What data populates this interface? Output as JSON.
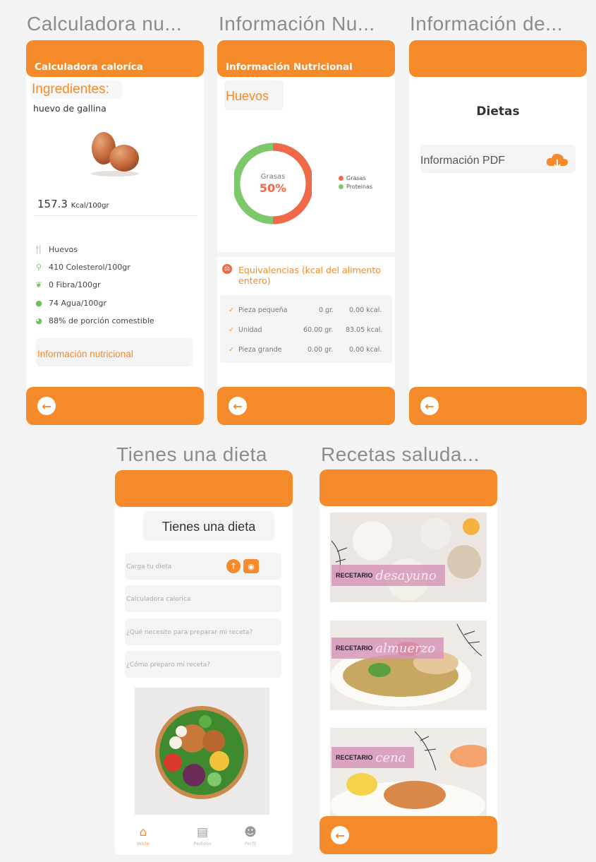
{
  "frames": {
    "calc": "Calculadora nu...",
    "info": "Información Nu...",
    "diet_info": "Información de...",
    "diet": "Tienes una dieta",
    "recipes": "Recetas saluda..."
  },
  "calc_screen": {
    "header": "Calculadora caloríca",
    "ingredients_label": "Ingredientes:",
    "ingredient": "huevo de gallina",
    "kcal_value": "157.3",
    "kcal_unit": "Kcal/100gr",
    "items": [
      {
        "icon": "fork-knife-icon",
        "text": "Huevos"
      },
      {
        "icon": "molecule-icon",
        "text": "410 Colesterol/100gr"
      },
      {
        "icon": "leaf-icon",
        "text": "0 Fibra/100gr"
      },
      {
        "icon": "drop-icon",
        "text": "74 Agua/100gr"
      },
      {
        "icon": "pie-icon",
        "text": "88% de porción comestible"
      }
    ],
    "nutrition_button": "Información nutricional"
  },
  "info_screen": {
    "header": "Información Nutricional",
    "food": "Huevos",
    "donut_label": "Grasas",
    "donut_percent": "50%",
    "legend": [
      {
        "name": "Grasas",
        "color": "#f06a4a"
      },
      {
        "name": "Proteinas",
        "color": "#7cc86a"
      }
    ],
    "equiv_title": "Equivalencias (kcal del alimento entero)",
    "equiv_rows": [
      {
        "name": "Pieza pequeña",
        "grams": "0 gr.",
        "kcal": "0.00 kcal."
      },
      {
        "name": "Unidad",
        "grams": "60.00 gr.",
        "kcal": "83.05 kcal."
      },
      {
        "name": "Pieza grande",
        "grams": "0.00 gr.",
        "kcal": "0.00 kcal."
      }
    ]
  },
  "chart_data": {
    "type": "pie",
    "categories": [
      "Grasas",
      "Proteinas"
    ],
    "values": [
      50,
      50
    ],
    "title": "",
    "legend": "right"
  },
  "diet_info_screen": {
    "title": "Dietas",
    "pdf_label": "Información PDF"
  },
  "diet_screen": {
    "title": "Tienes una dieta",
    "fields": [
      "Carga tu dieta",
      "Calculadora calorica",
      "¿Qué necesito para preparar mi receta?",
      "¿Cómo preparo mi receta?"
    ],
    "nav": [
      "Inicio",
      "Pedidos",
      "Perfil"
    ]
  },
  "recipes_screen": {
    "word": "RECETARIO",
    "items": [
      "desayuno",
      "almuerzo",
      "cena"
    ]
  },
  "colors": {
    "accent": "#f58a2a",
    "chip": "#f4f4f4"
  }
}
